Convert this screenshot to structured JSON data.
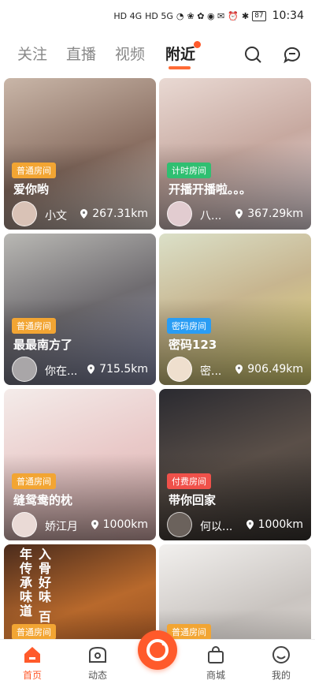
{
  "status": {
    "time": "10:34",
    "battery": "87",
    "network1": "HD 4G",
    "network2": "HD 5G"
  },
  "tabs": [
    {
      "label": "关注"
    },
    {
      "label": "直播"
    },
    {
      "label": "视频"
    },
    {
      "label": "附近"
    }
  ],
  "colors": {
    "accent": "#ff5a2b",
    "badge_normal": "#f2a533",
    "badge_timed": "#2fbf71",
    "badge_password": "#2a9df4",
    "badge_paid": "#f0514a"
  },
  "cards": [
    {
      "badge": "普通房间",
      "title": "爱你哟",
      "name": "小文",
      "distance": "267.31km"
    },
    {
      "badge": "计时房间",
      "title": "开播开播啦。。。",
      "name": "八...",
      "distance": "367.29km"
    },
    {
      "badge": "普通房间",
      "title": "最最南方了",
      "name": "你在...",
      "distance": "715.5km"
    },
    {
      "badge": "密码房间",
      "title": "密码123",
      "name": "密...",
      "distance": "906.49km"
    },
    {
      "badge": "普通房间",
      "title": "缝鸳鸯的枕",
      "name": "娇江月",
      "distance": "1000km"
    },
    {
      "badge": "付费房间",
      "title": "带你回家",
      "name": "何以...",
      "distance": "1000km"
    },
    {
      "badge": "普通房间",
      "title": "",
      "name": "",
      "distance": "",
      "overlay_text": "入骨好味 百年传承味道"
    },
    {
      "badge": "普通房间",
      "title": "",
      "name": "",
      "distance": ""
    }
  ],
  "bottom_nav": [
    {
      "label": "首页"
    },
    {
      "label": "动态"
    },
    {
      "label": "商城"
    },
    {
      "label": "我的"
    }
  ]
}
